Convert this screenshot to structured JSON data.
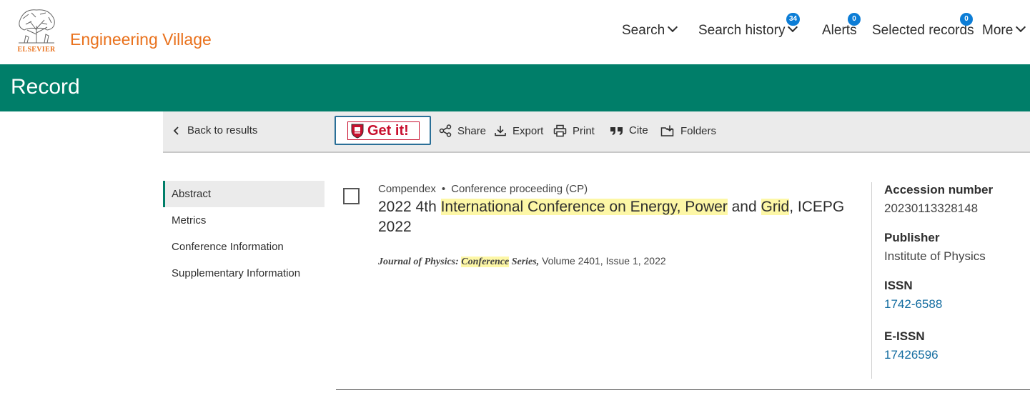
{
  "header": {
    "logo_text": "ELSEVIER",
    "brand": "Engineering Village",
    "nav": {
      "search": "Search",
      "search_history": "Search history",
      "search_history_count": "34",
      "alerts": "Alerts",
      "alerts_count": "0",
      "selected_records": "Selected records",
      "selected_records_count": "0",
      "more": "More"
    }
  },
  "banner": {
    "title": "Record"
  },
  "toolbar": {
    "back": "Back to results",
    "getit": "Get it!",
    "share": "Share",
    "export": "Export",
    "print": "Print",
    "cite": "Cite",
    "folders": "Folders"
  },
  "sidenav": {
    "items": [
      "Abstract",
      "Metrics",
      "Conference Information",
      "Supplementary Information"
    ]
  },
  "record": {
    "database": "Compendex",
    "separator": "•",
    "doc_type": "Conference proceeding (CP)",
    "title_parts": {
      "p1": "2022 4th ",
      "h1": "International Conference on Energy, Power",
      "p2": " and ",
      "h2": "Grid",
      "p3": ", ICEPG 2022"
    },
    "source": {
      "journal_prefix": "Journal of Physics: ",
      "journal_hl": "Conference",
      "journal_suffix": " Series,",
      "details": " Volume 2401, Issue 1, 2022"
    }
  },
  "info": {
    "accession_label": "Accession number",
    "accession_value": "20230113328148",
    "publisher_label": "Publisher",
    "publisher_value": "Institute of Physics",
    "issn_label": "ISSN",
    "issn_value": "1742-6588",
    "eissn_label": "E-ISSN",
    "eissn_value": "17426596"
  },
  "colors": {
    "brand_orange": "#e9711c",
    "banner_green": "#007e69",
    "badge_blue": "#0c7dd6",
    "highlight": "#fdf7a6",
    "link": "#136ca0"
  }
}
